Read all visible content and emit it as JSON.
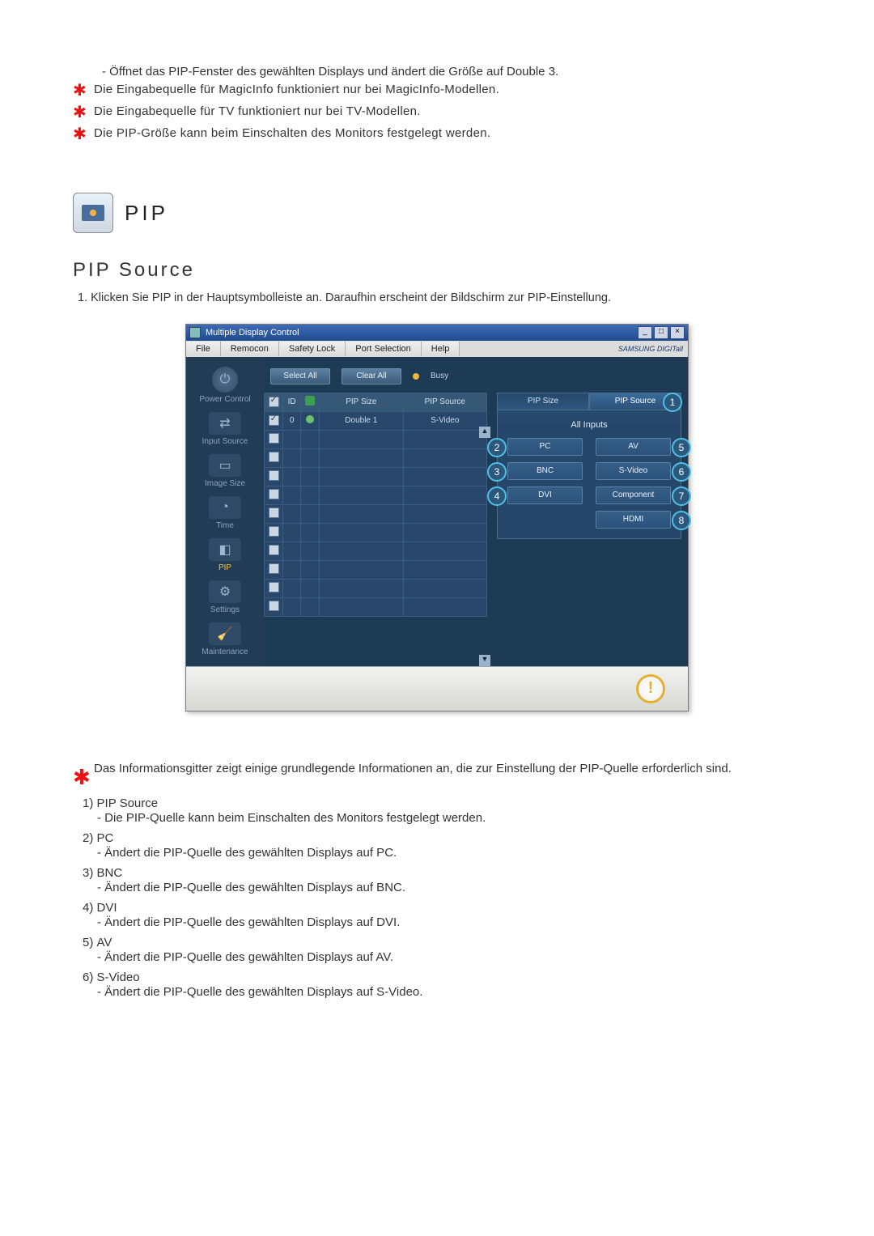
{
  "intro": {
    "dash1": "- Öffnet das PIP-Fenster des gewählten Displays und ändert die Größe auf Double 3.",
    "star1": "Die Eingabequelle für MagicInfo funktioniert nur bei MagicInfo-Modellen.",
    "star2": "Die Eingabequelle für TV funktioniert nur bei TV-Modellen.",
    "star3": "Die PIP-Größe kann beim Einschalten des Monitors festgelegt werden."
  },
  "heading_icon_title": "PIP",
  "subheading": "PIP Source",
  "numtext": "1.  Klicken Sie PIP in der Hauptsymbolleiste an. Daraufhin erscheint der Bildschirm zur PIP-Einstellung.",
  "window": {
    "title": "Multiple Display Control",
    "win_min": "_",
    "win_max": "□",
    "win_close": "×",
    "menus": [
      "File",
      "Remocon",
      "Safety Lock",
      "Port Selection",
      "Help"
    ],
    "brand": "SAMSUNG DIGITall",
    "sidebar": [
      {
        "label": "Power Control"
      },
      {
        "label": "Input Source"
      },
      {
        "label": "Image Size"
      },
      {
        "label": "Time"
      },
      {
        "label": "PIP"
      },
      {
        "label": "Settings"
      },
      {
        "label": "Maintenance"
      }
    ],
    "toolbar": {
      "select_all": "Select All",
      "clear_all": "Clear All",
      "busy": "Busy"
    },
    "table": {
      "headers": {
        "chk": "",
        "id": "ID",
        "status": "",
        "size": "PIP Size",
        "source": "PIP Source"
      },
      "row": {
        "id": "0",
        "size": "Double 1",
        "source": "S-Video"
      }
    },
    "tabs": {
      "size": "PIP Size",
      "source": "PIP Source"
    },
    "all_inputs": "All Inputs",
    "sources": {
      "pc": "PC",
      "av": "AV",
      "bnc": "BNC",
      "svideo": "S-Video",
      "dvi": "DVI",
      "component": "Component",
      "hdmi": "HDMI"
    },
    "callouts": {
      "c1": "1",
      "c2": "2",
      "c3": "3",
      "c4": "4",
      "c5": "5",
      "c6": "6",
      "c7": "7",
      "c8": "8"
    }
  },
  "notes": {
    "note1": "Das Informationsgitter zeigt einige grundlegende Informationen an, die zur Einstellung der PIP-Quelle erforderlich sind.",
    "items": [
      {
        "n": "1)",
        "t": "PIP Source",
        "d": "- Die PIP-Quelle kann beim Einschalten des Monitors festgelegt werden."
      },
      {
        "n": "2)",
        "t": "PC",
        "d": "- Ändert die PIP-Quelle des gewählten Displays auf PC."
      },
      {
        "n": "3)",
        "t": "BNC",
        "d": "- Ändert die PIP-Quelle des gewählten Displays auf BNC."
      },
      {
        "n": "4)",
        "t": "DVI",
        "d": "- Ändert die PIP-Quelle des gewählten Displays auf DVI."
      },
      {
        "n": "5)",
        "t": "AV",
        "d": "- Ändert die PIP-Quelle des gewählten Displays auf AV."
      },
      {
        "n": "6)",
        "t": "S-Video",
        "d": "- Ändert die PIP-Quelle des gewählten Displays auf S-Video."
      }
    ]
  }
}
